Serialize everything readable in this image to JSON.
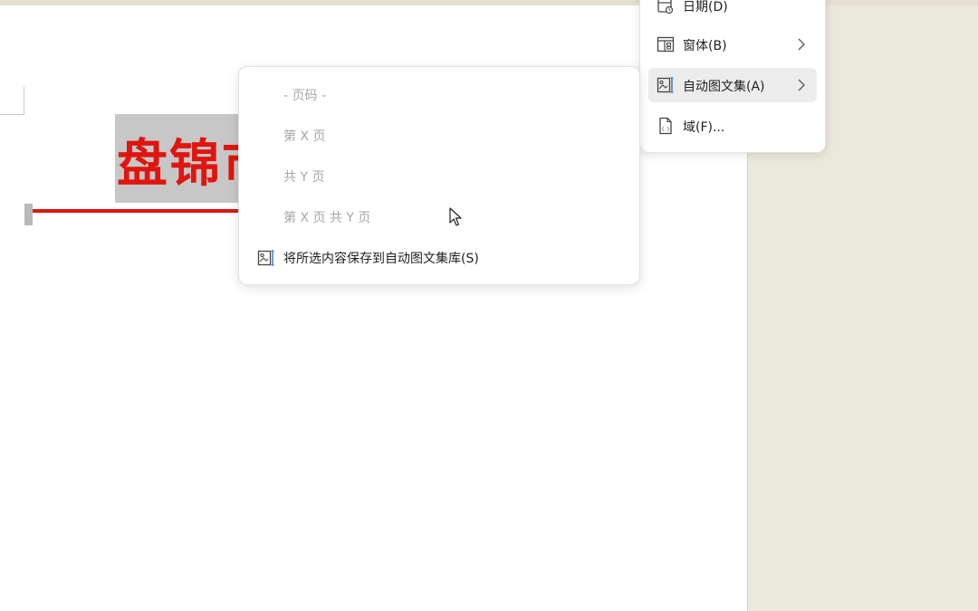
{
  "document": {
    "title_fragment": "盘锦市"
  },
  "main_menu": {
    "items": [
      {
        "label": "日期(D)",
        "icon": "calendar-clock-icon",
        "has_submenu": false
      },
      {
        "label": "窗体(B)",
        "icon": "form-icon",
        "has_submenu": true
      },
      {
        "label": "自动图文集(A)",
        "icon": "autotext-icon",
        "has_submenu": true,
        "highlighted": true
      },
      {
        "label": "域(F)...",
        "icon": "field-document-icon",
        "has_submenu": false
      }
    ]
  },
  "autotext_submenu": {
    "items": [
      {
        "label": "- 页码 -",
        "enabled": false
      },
      {
        "label": "第 X 页",
        "enabled": false
      },
      {
        "label": "共 Y 页",
        "enabled": false
      },
      {
        "label": "第 X 页 共 Y 页",
        "enabled": false
      },
      {
        "label": "将所选内容保存到自动图文集库(S)",
        "enabled": true,
        "icon": "save-autotext-icon"
      }
    ]
  },
  "colors": {
    "title_red": "#e0150f",
    "menu_hover": "#ececec",
    "disabled_text": "#a6a6a6",
    "background": "#ebe8dc"
  }
}
